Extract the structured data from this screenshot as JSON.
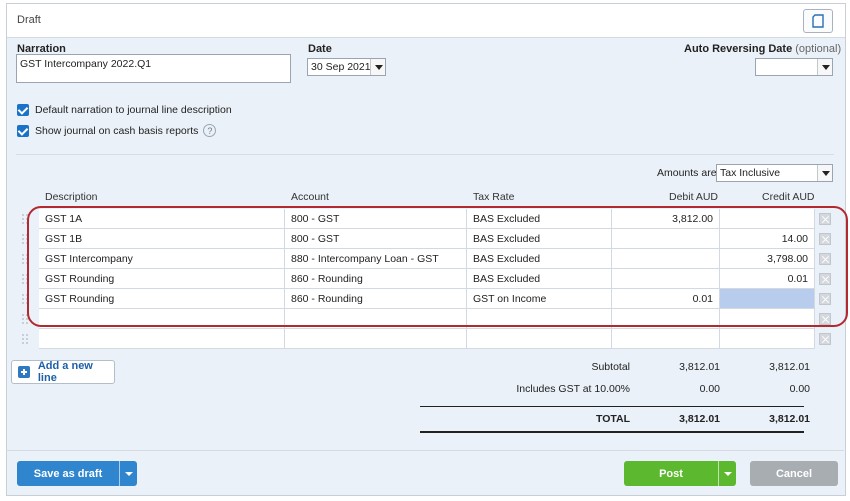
{
  "window": {
    "title": "Draft"
  },
  "form": {
    "narration_label": "Narration",
    "narration_value": "GST Intercompany 2022.Q1",
    "date_label": "Date",
    "date_value": "30 Sep 2021",
    "auto_reversing_label": "Auto Reversing Date",
    "auto_reversing_optional": "(optional)",
    "auto_reversing_value": "",
    "checkbox_default_narration": {
      "label": "Default narration to journal line description",
      "checked": true
    },
    "checkbox_cash_basis": {
      "label": "Show journal on cash basis reports",
      "checked": true
    },
    "help_symbol": "?",
    "amounts_are_label": "Amounts are",
    "amounts_are_value": "Tax Inclusive"
  },
  "table": {
    "columns": [
      "Description",
      "Account",
      "Tax Rate",
      "Debit AUD",
      "Credit AUD"
    ],
    "rows": [
      {
        "description": "GST 1A",
        "account": "800 - GST",
        "tax_rate": "BAS Excluded",
        "debit": "3,812.00",
        "credit": ""
      },
      {
        "description": "GST 1B",
        "account": "800 - GST",
        "tax_rate": "BAS Excluded",
        "debit": "",
        "credit": "14.00"
      },
      {
        "description": "GST Intercompany",
        "account": "880 - Intercompany Loan - GST",
        "tax_rate": "BAS Excluded",
        "debit": "",
        "credit": "3,798.00"
      },
      {
        "description": "GST Rounding",
        "account": "860 - Rounding",
        "tax_rate": "BAS Excluded",
        "debit": "",
        "credit": "0.01"
      },
      {
        "description": "GST Rounding",
        "account": "860 - Rounding",
        "tax_rate": "GST on Income",
        "debit": "0.01",
        "credit": ""
      },
      {
        "description": "",
        "account": "",
        "tax_rate": "",
        "debit": "",
        "credit": ""
      },
      {
        "description": "",
        "account": "",
        "tax_rate": "",
        "debit": "",
        "credit": ""
      }
    ]
  },
  "add_line_label": "Add a new line",
  "totals": {
    "subtotal_label": "Subtotal",
    "subtotal_debit": "3,812.01",
    "subtotal_credit": "3,812.01",
    "gst_label": "Includes GST at 10.00%",
    "gst_debit": "0.00",
    "gst_credit": "0.00",
    "total_label": "TOTAL",
    "total_debit": "3,812.01",
    "total_credit": "3,812.01"
  },
  "buttons": {
    "save_draft": "Save as draft",
    "post": "Post",
    "cancel": "Cancel"
  },
  "colors": {
    "save_blue": "#2f86cf",
    "post_green": "#5cb82e",
    "cancel_gray": "#a8adb2",
    "highlight_red": "#b22a30",
    "selected_cell": "#b8cdee"
  }
}
